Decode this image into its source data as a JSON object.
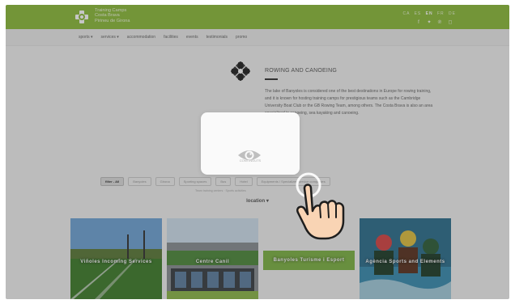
{
  "header": {
    "logo_lines": [
      "Training Camps",
      "Costa Brava",
      "Pirineu de Girona"
    ],
    "languages": [
      "CA",
      "ES",
      "EN",
      "FR",
      "DE"
    ],
    "active_language": "EN",
    "social_icons": [
      "facebook-icon",
      "twitter-icon",
      "pinterest-icon",
      "instagram-icon"
    ],
    "brand_color": "#8dbc3b"
  },
  "nav": {
    "items": [
      "sports ▾",
      "services ▾",
      "accommodation",
      "facilities",
      "events",
      "testimonials",
      "promo"
    ]
  },
  "section": {
    "icon": "rowing-icon",
    "title": "ROWING AND CANOEING",
    "paragraph": "The lake of Banyoles is considered one of the best destinations in Europe for rowing training, and it is known for hosting training camps for prestigious teams such as the Cambridge University Boat Club or the GB Rowing Team, among others. The Costa Brava is also an area specialised in canoeing, sea kayaking and canoeing."
  },
  "filters": {
    "items": [
      "filter - All",
      "Banyoles",
      "Girona",
      "Sporting spaces",
      "Bus",
      "Hotel",
      "Equipments / Specialized service companies"
    ],
    "active": "filter - All",
    "subfilter_text": "Team training centers · Sports activities"
  },
  "location": {
    "label": "location",
    "chevron": "▾"
  },
  "cards": [
    {
      "label": "Viñoles Incoming Services"
    },
    {
      "label": "Centre Canil"
    },
    {
      "label": "Banyoles Turisme i Esport"
    },
    {
      "label": "Agència Sports and Elements"
    }
  ],
  "overlay": {
    "caption": "CONTINGUTS",
    "eye_icon": "eye-icon",
    "hand_icon": "pointing-hand-icon"
  }
}
